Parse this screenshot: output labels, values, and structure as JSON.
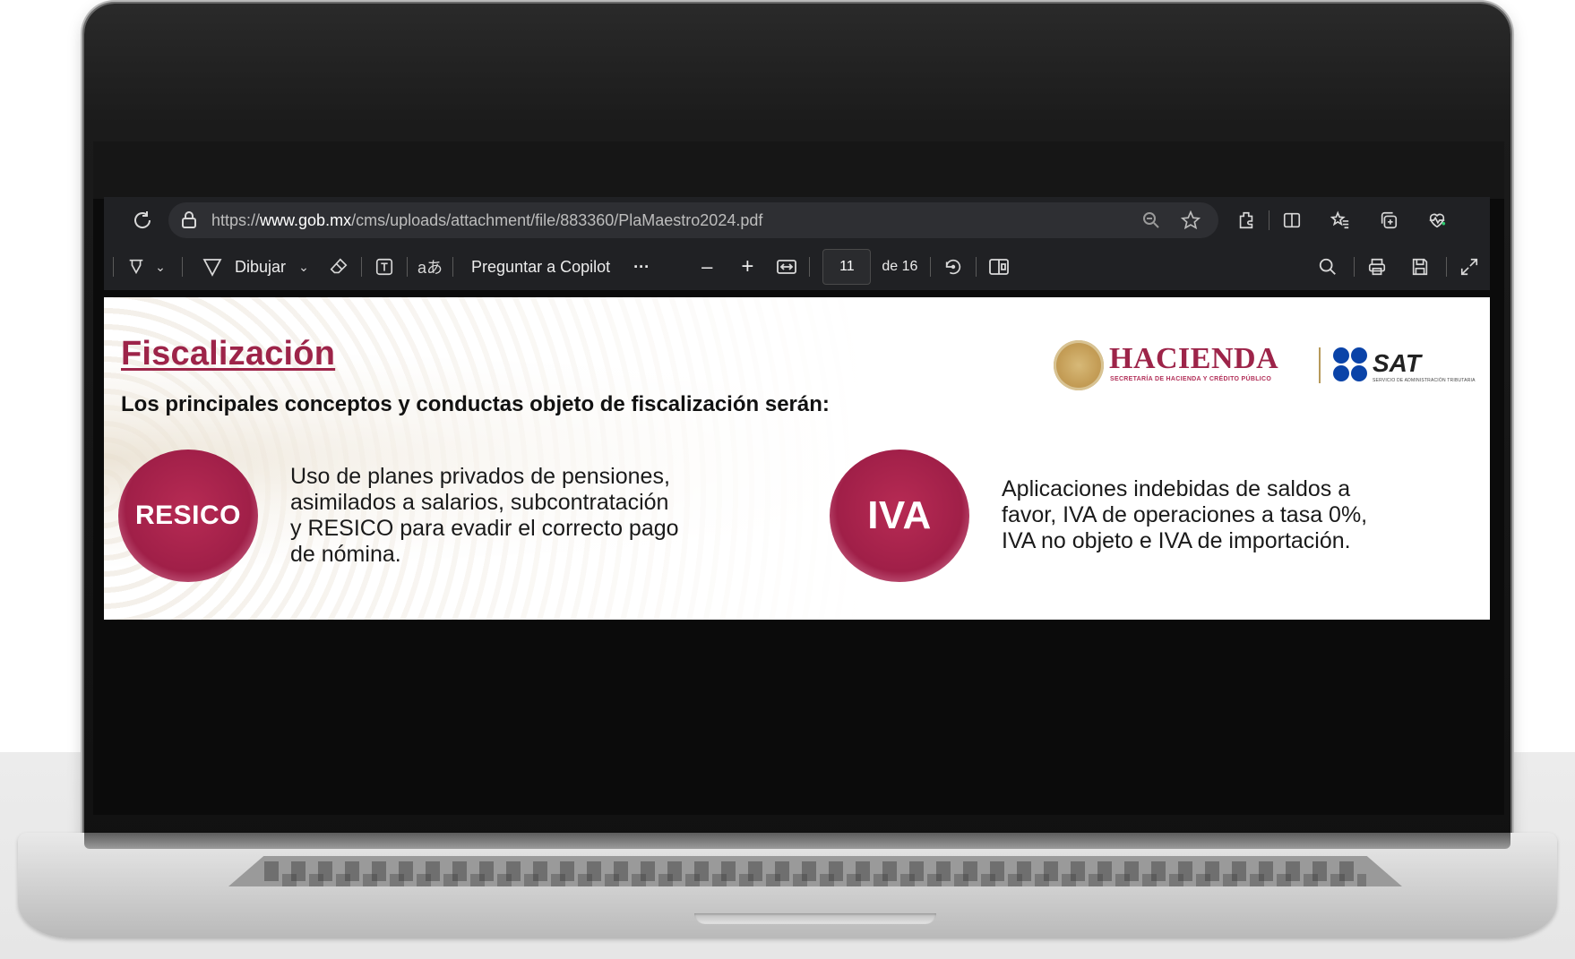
{
  "browser": {
    "url_prefix": "https://",
    "url_domain": "www.gob.mx",
    "url_path": "/cms/uploads/attachment/file/883360/PlaMaestro2024.pdf"
  },
  "pdf_toolbar": {
    "draw_label": "Dibujar",
    "copilot_label": "Preguntar a Copilot",
    "more_label": "···",
    "zoom_out_label": "–",
    "zoom_in_label": "+",
    "page_current": "11",
    "page_total_label": "de 16"
  },
  "slide": {
    "title": "Fiscalización",
    "subtitle": "Los principales conceptos y conductas objeto de fiscalización serán:",
    "logo_hacienda": "HACIENDA",
    "logo_hacienda_sub": "SECRETARÍA DE HACIENDA Y CRÉDITO PÚBLICO",
    "logo_sat": "SAT",
    "logo_sat_sub": "SERVICIO DE ADMINISTRACIÓN TRIBUTARIA",
    "items": [
      {
        "badge": "RESICO",
        "text": "Uso de planes privados de pensiones,\nasimilados a salarios, subcontratación\ny RESICO para evadir el correcto pago\nde nómina."
      },
      {
        "badge": "IVA",
        "text": "Aplicaciones indebidas de saldos a\nfavor, IVA de operaciones a tasa 0%,\nIVA no objeto e IVA de importación."
      }
    ]
  },
  "colors": {
    "brand_guinda": "#9d2449",
    "sat_blue": "#0a43a8",
    "browser_bg": "#202124"
  }
}
